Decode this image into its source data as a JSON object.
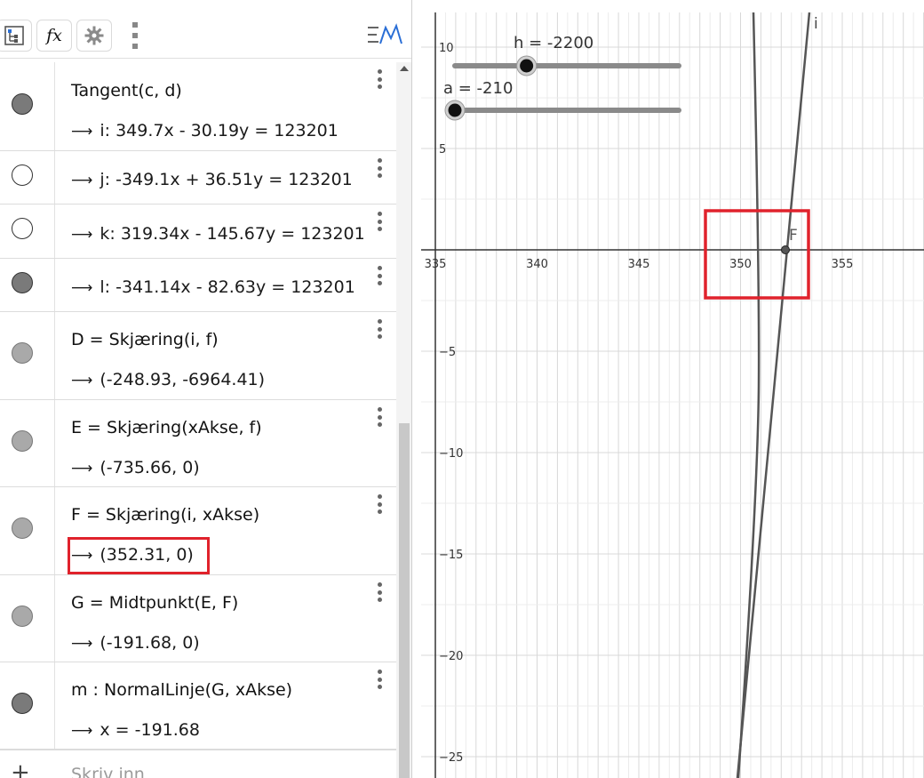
{
  "toolbar": {
    "algebra_icon": "tree-view-icon",
    "fx_label": "fx",
    "settings_icon": "gear-icon",
    "more_icon": "kebab-icon",
    "graph_style_icon": "graph-style-icon"
  },
  "rows": [
    {
      "line1": "Tangent(c, d)",
      "line2": "i: 349.7x - 30.19y = 123201",
      "state": "dark"
    },
    {
      "line1": "",
      "line2": "j: -349.1x + 36.51y = 123201",
      "state": "empty"
    },
    {
      "line1": "",
      "line2": "k: 319.34x - 145.67y = 123201",
      "state": "empty"
    },
    {
      "line1": "",
      "line2": "l: -341.14x - 82.63y = 123201",
      "state": "dark"
    },
    {
      "line1": "D = Skjæring(i, f)",
      "line2": "(-248.93, -6964.41)",
      "state": "light"
    },
    {
      "line1": "E = Skjæring(xAkse, f)",
      "line2": "(-735.66, 0)",
      "state": "light"
    },
    {
      "line1": "F = Skjæring(i, xAkse)",
      "line2": "(352.31, 0)",
      "state": "light"
    },
    {
      "line1": "G = Midtpunkt(E, F)",
      "line2": "(-191.68, 0)",
      "state": "light"
    },
    {
      "line1": "m : NormalLinje(G, xAkse)",
      "line2": "x = -191.68",
      "state": "dark"
    }
  ],
  "arrow_glyph": "⟶",
  "input": {
    "placeholder": "Skriv inn"
  },
  "graphics": {
    "slider_h_label": "h = -2200",
    "slider_a_label": "a = -210",
    "slider_h_level": 0.32,
    "slider_a_level": 0.0,
    "point_label": "F",
    "line_label": "i",
    "x_ticks": [
      "335",
      "340",
      "345",
      "350",
      "355"
    ],
    "y_ticks": [
      "10",
      "5",
      "−5",
      "−10",
      "−15",
      "−20",
      "−25"
    ],
    "x_tick_values": [
      335,
      340,
      345,
      350,
      355
    ],
    "y_tick_values": [
      10,
      5,
      -5,
      -10,
      -15,
      -20,
      -25
    ],
    "highlight_color": "#e0222c"
  }
}
